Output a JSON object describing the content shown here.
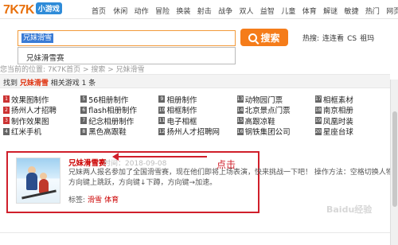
{
  "logo": {
    "main": "7K7K",
    "sub": "小游戏"
  },
  "nav": [
    "首页",
    "休闲",
    "动作",
    "冒险",
    "换装",
    "射击",
    "战争",
    "双人",
    "益智",
    "儿童",
    "体育",
    "解谜",
    "敏捷",
    "热门",
    "网页"
  ],
  "search": {
    "value": "兄妹滑雪",
    "button": "搜索",
    "hot_label": "热搜:",
    "hot_items": [
      "连连看",
      "CS",
      "祖玛"
    ]
  },
  "suggestion": "兄妹滑雪赛",
  "breadcrumb": "您当前的位置: 7K7K首页 > 搜索 > 兄妹滑雪",
  "result": {
    "prefix": "找到",
    "keyword": "兄妹滑雪",
    "suffix": "相关游戏",
    "count": "1",
    "unit": "条"
  },
  "grid": [
    [
      {
        "n": "1",
        "t": "效果图制作"
      },
      {
        "n": "5",
        "t": "56相册制作"
      },
      {
        "n": "9",
        "t": "相册制作"
      },
      {
        "n": "13",
        "t": "动物园门票"
      },
      {
        "n": "17",
        "t": "相框素材"
      }
    ],
    [
      {
        "n": "2",
        "t": "扬州人才招聘"
      },
      {
        "n": "6",
        "t": "flash相册制作"
      },
      {
        "n": "10",
        "t": "相框制作"
      },
      {
        "n": "14",
        "t": "北京景点门票"
      },
      {
        "n": "18",
        "t": "南京相册"
      }
    ],
    [
      {
        "n": "3",
        "t": "制作效果图"
      },
      {
        "n": "7",
        "t": "纪念相册制作"
      },
      {
        "n": "11",
        "t": "电子相框"
      },
      {
        "n": "15",
        "t": "高跟凉鞋"
      },
      {
        "n": "19",
        "t": "凤凰时装"
      }
    ],
    [
      {
        "n": "4",
        "t": "红米手机"
      },
      {
        "n": "8",
        "t": "黑色高跟鞋"
      },
      {
        "n": "12",
        "t": "扬州人才招聘网"
      },
      {
        "n": "16",
        "t": "钢铁集团公司"
      },
      {
        "n": "20",
        "t": "星座台球"
      }
    ]
  ],
  "card": {
    "title": "兄妹滑雪赛",
    "date": "时间：2018-09-08",
    "description": "兄妹两人报名参加了全国滑雪赛，现在他们即将上场表演，快来挑战一下吧！ 操作方法：空格切换人物，方向键上跳跃，方向键↓下蹲，方向键→加速。",
    "tags_label": "标签:",
    "tags": [
      "滑雪",
      "体育"
    ]
  },
  "annotation": "点击",
  "watermark": "Baidu经验"
}
